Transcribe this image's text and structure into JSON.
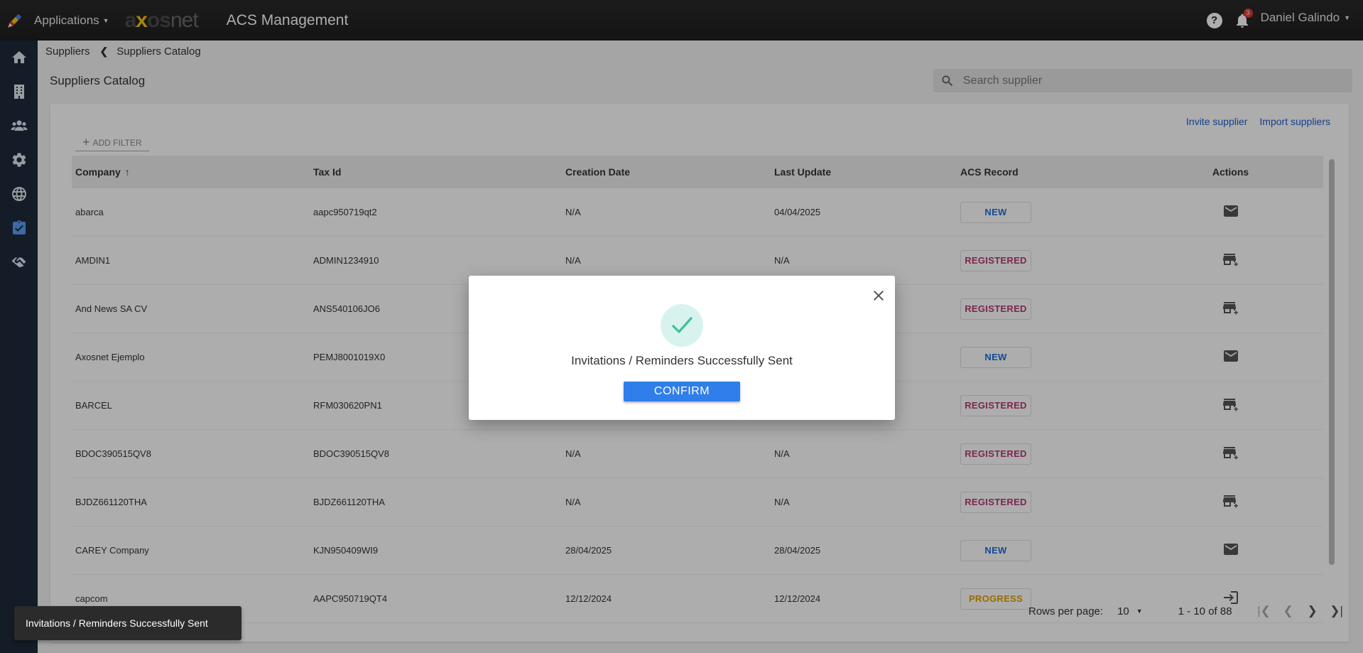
{
  "topbar": {
    "apps_label": "Applications",
    "brand_a": "a",
    "brand_x": "x",
    "brand_os": "os",
    "brand_net": "net",
    "module_title": "ACS Management",
    "help": "?",
    "notifications_count": "3",
    "user_name": "Daniel Galindo"
  },
  "sidebar": {
    "items": [
      "home-icon",
      "building-icon",
      "users-icon",
      "gear-icon",
      "globe-icon",
      "clipboard-check-icon",
      "handshake-icon"
    ],
    "active_color": "#5b9bf3"
  },
  "breadcrumb": {
    "root": "Suppliers",
    "current": "Suppliers Catalog"
  },
  "page": {
    "title": "Suppliers Catalog",
    "search_placeholder": "Search supplier"
  },
  "toolbar": {
    "invite": "Invite supplier",
    "import": "Import suppliers",
    "add_filter": "ADD FILTER"
  },
  "table": {
    "columns": [
      "Company",
      "Tax Id",
      "Creation Date",
      "Last Update",
      "ACS Record",
      "Actions"
    ],
    "rows": [
      {
        "company": "abarca",
        "tax_id": "aapc950719qt2",
        "created": "N/A",
        "updated": "04/04/2025",
        "record": "NEW",
        "action": "mail-icon"
      },
      {
        "company": "AMDIN1",
        "tax_id": "ADMIN1234910",
        "created": "N/A",
        "updated": "N/A",
        "record": "REGISTERED",
        "action": "store-add-icon"
      },
      {
        "company": "And News SA CV",
        "tax_id": "ANS540106JO6",
        "created": "",
        "updated": "",
        "record": "REGISTERED",
        "action": "store-add-icon"
      },
      {
        "company": "Axosnet Ejemplo",
        "tax_id": "PEMJ8001019X0",
        "created": "",
        "updated": "",
        "record": "NEW",
        "action": "mail-icon"
      },
      {
        "company": "BARCEL",
        "tax_id": "RFM030620PN1",
        "created": "",
        "updated": "",
        "record": "REGISTERED",
        "action": "store-add-icon"
      },
      {
        "company": "BDOC390515QV8",
        "tax_id": "BDOC390515QV8",
        "created": "N/A",
        "updated": "N/A",
        "record": "REGISTERED",
        "action": "store-add-icon"
      },
      {
        "company": "BJDZ661120THA",
        "tax_id": "BJDZ661120THA",
        "created": "N/A",
        "updated": "N/A",
        "record": "REGISTERED",
        "action": "store-add-icon"
      },
      {
        "company": "CAREY Company",
        "tax_id": "KJN950409WI9",
        "created": "28/04/2025",
        "updated": "28/04/2025",
        "record": "NEW",
        "action": "mail-icon"
      },
      {
        "company": "capcom",
        "tax_id": "AAPC950719QT4",
        "created": "12/12/2024",
        "updated": "12/12/2024",
        "record": "PROGRESS",
        "action": "login-icon"
      }
    ]
  },
  "pagination": {
    "rows_per_page_label": "Rows per page:",
    "rows_per_page": "10",
    "range": "1 - 10 of 88"
  },
  "dialog": {
    "message": "Invitations / Reminders Successfully Sent",
    "confirm": "CONFIRM"
  },
  "snackbar": {
    "message": "Invitations / Reminders Successfully Sent"
  }
}
